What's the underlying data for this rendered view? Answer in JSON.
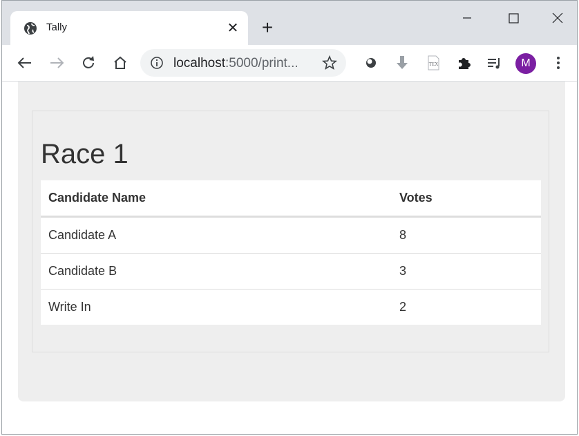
{
  "browser": {
    "tab_title": "Tally",
    "url_host": "localhost",
    "url_path": ":5000/print...",
    "avatar_letter": "M",
    "avatar_color": "#7b1fa2"
  },
  "page": {
    "race_title": "Race 1",
    "table": {
      "headers": [
        "Candidate Name",
        "Votes"
      ],
      "rows": [
        {
          "name": "Candidate A",
          "votes": "8"
        },
        {
          "name": "Candidate B",
          "votes": "3"
        },
        {
          "name": "Write In",
          "votes": "2"
        }
      ]
    }
  }
}
